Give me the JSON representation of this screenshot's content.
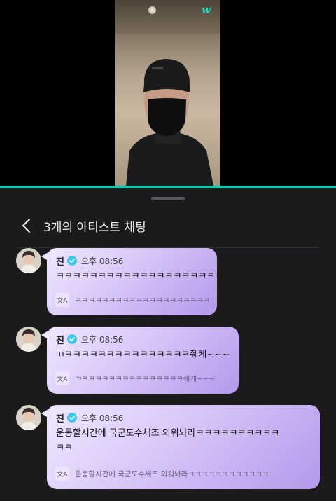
{
  "video": {
    "watermark": "w"
  },
  "header": {
    "title": "3개의 아티스트 채팅"
  },
  "messages": [
    {
      "name": "진",
      "time": "오후 08:56",
      "text": "ㅋㅋㅋㅋㅋㅋㅋㅋㅋㅋㅋㅋㅋㅋㅋㅋㅋㅋㅋㅋ",
      "translation": "ㅋㅋㅋㅋㅋㅋㅋㅋㅋㅋㅋㅋㅋㅋㅋㅋㅋㅋㅋㅋ"
    },
    {
      "name": "진",
      "time": "오후 08:56",
      "text": "ㄲㅋㅋㅋㅋㅋㅋㅋㅋㅋㅋㅋㅋㅋㅋㅋ줴케~~~",
      "translation": "ㄲㅋㅋㅋㅋㅋㅋㅋㅋㅋㅋㅋㅋㅋㅋㅋ줴케~~~"
    },
    {
      "name": "진",
      "time": "오후 08:56",
      "text_line1": "운동할시간에 국군도수체조 외워놔라ㅋㅋㅋㅋㅋㅋㅋㅋㅋㅋ",
      "text_line2": "ㅋㅋ",
      "translation": "운동할시간에 국군도수체조 외워놔라ㅋㅋㅋㅋㅋㅋㅋㅋㅋㅋㅋㅋ"
    }
  ],
  "icons": {
    "back": "chevron-left-icon",
    "verified": "verified-badge-icon",
    "translate": "translate-icon"
  },
  "colors": {
    "accent": "#16c6aa",
    "bubble_start": "#f0e9ff",
    "bubble_end": "#b598ec",
    "verified": "#3ec9e8"
  }
}
